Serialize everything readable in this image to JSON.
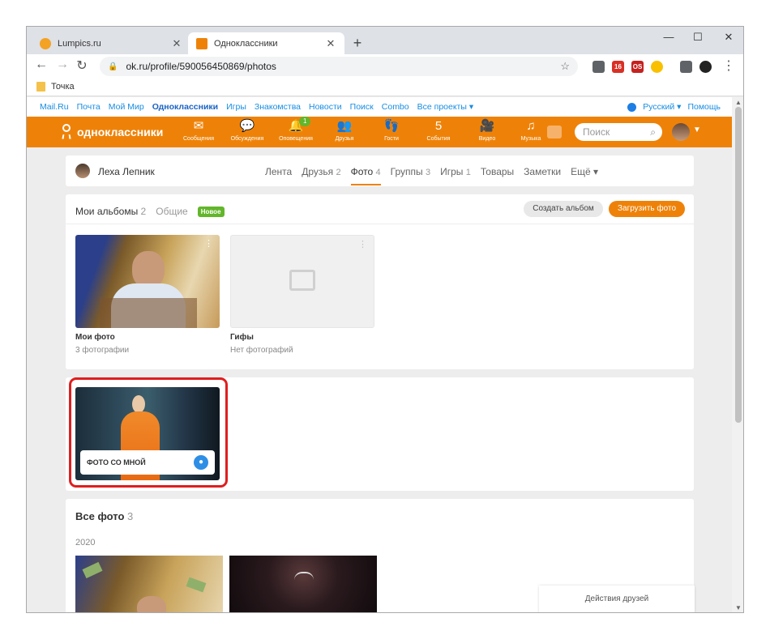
{
  "browser": {
    "tabs": [
      {
        "title": "Lumpics.ru",
        "active": false,
        "favicon_color": "#f4a223"
      },
      {
        "title": "Одноклассники",
        "active": true,
        "favicon_color": "#ee8208"
      }
    ],
    "new_tab": "+",
    "window_controls": {
      "minimize": "—",
      "maximize": "☐",
      "close": "✕"
    },
    "url": "ok.ru/profile/590056450869/photos",
    "bookmarks": [
      {
        "label": "Точка"
      }
    ],
    "extension_badge": "16",
    "extension_os_label": "OS"
  },
  "mailru_bar": {
    "links": [
      "Mail.Ru",
      "Почта",
      "Мой Мир",
      "Одноклассники",
      "Игры",
      "Знакомства",
      "Новости",
      "Поиск",
      "Combo",
      "Все проекты ▾"
    ],
    "language": "Русский ▾",
    "help": "Помощь"
  },
  "ok_header": {
    "logo_text": "одноклассники",
    "nav": [
      {
        "icon": "✉",
        "label": "Сообщения",
        "badge": ""
      },
      {
        "icon": "💬",
        "label": "Обсуждения",
        "badge": ""
      },
      {
        "icon": "🔔",
        "label": "Оповещения",
        "badge": "1"
      },
      {
        "icon": "👥",
        "label": "Друзья",
        "badge": ""
      },
      {
        "icon": "👣",
        "label": "Гости",
        "badge": ""
      },
      {
        "icon": "5",
        "label": "События",
        "badge": ""
      },
      {
        "icon": "🎥",
        "label": "Видео",
        "badge": ""
      },
      {
        "icon": "♫",
        "label": "Музыка",
        "badge": ""
      }
    ],
    "search_placeholder": "Поиск",
    "accent_color": "#ee8208"
  },
  "profile": {
    "name": "Леха Лепник",
    "nav": [
      {
        "label": "Лента",
        "count": ""
      },
      {
        "label": "Друзья",
        "count": "2"
      },
      {
        "label": "Фото",
        "count": "4",
        "active": true
      },
      {
        "label": "Группы",
        "count": "3"
      },
      {
        "label": "Игры",
        "count": "1"
      },
      {
        "label": "Товары",
        "count": ""
      },
      {
        "label": "Заметки",
        "count": ""
      },
      {
        "label": "Ещё ▾",
        "count": ""
      }
    ]
  },
  "albums": {
    "tab_mine": "Мои альбомы",
    "tab_mine_count": "2",
    "tab_shared": "Общие",
    "new_badge": "Новое",
    "create_button": "Создать альбом",
    "upload_button": "Загрузить фото",
    "items": [
      {
        "name": "Мои фото",
        "count": "3 фотографии"
      },
      {
        "name": "Гифы",
        "count": "Нет фотографий"
      }
    ]
  },
  "photos_with_me": {
    "label": "ФОТО СО МНОЙ"
  },
  "all_photos": {
    "title": "Все фото",
    "count": "3",
    "year": "2020"
  },
  "friends_activity": "Действия друзей"
}
